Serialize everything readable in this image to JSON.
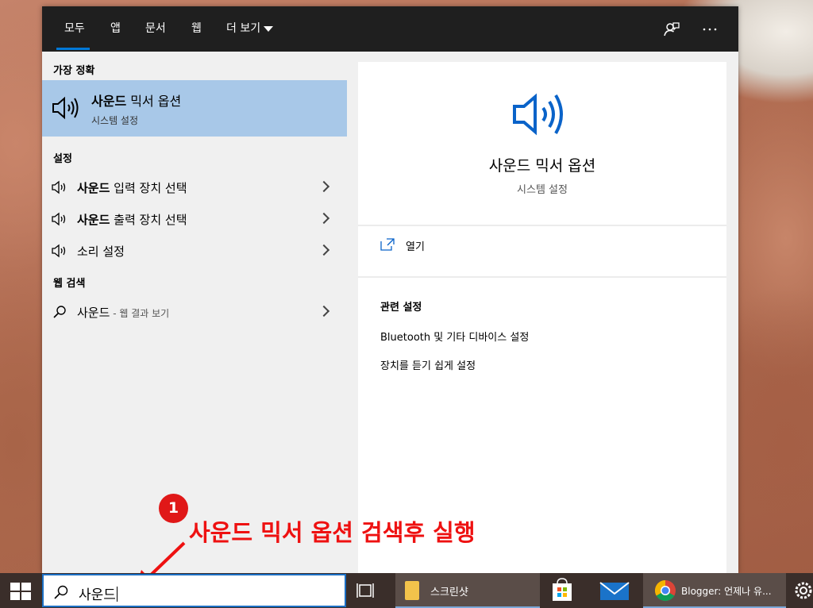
{
  "topnav": {
    "tabs": [
      "모두",
      "앱",
      "문서",
      "웹",
      "더 보기"
    ],
    "active_tab": "모두",
    "feedback_icon": "feedback-icon",
    "more_icon": "more-options-icon"
  },
  "left": {
    "best_match_heading": "가장 정확",
    "best_match": {
      "title_bold": "사운드",
      "title_rest": " 믹서 옵션",
      "subtitle": "시스템 설정",
      "icon": "speaker-icon"
    },
    "settings_heading": "설정",
    "settings_items": [
      {
        "bold": "사운드",
        "rest": " 입력 장치 선택"
      },
      {
        "bold": "사운드",
        "rest": " 출력 장치 선택"
      },
      {
        "bold": "",
        "rest": "소리 설정"
      }
    ],
    "web_heading": "웹 검색",
    "web_item": {
      "query": "사운드",
      "suffix": " - 웹 결과 보기"
    }
  },
  "right": {
    "title": "사운드 믹서 옵션",
    "subtitle": "시스템 설정",
    "open_label": "열기",
    "related_heading": "관련 설정",
    "related_links": [
      "Bluetooth 및 기타 디바이스 설정",
      "장치를 듣기 쉽게 설정"
    ]
  },
  "annotation": {
    "badge": "1",
    "text": "사운드 믹서 옵션 검색후 실행",
    "color": "#ee1111"
  },
  "taskbar": {
    "search_value": "사운드",
    "apps": [
      {
        "name": "folder",
        "label": "스크린샷"
      },
      {
        "name": "chrome",
        "label": "Blogger: 언제나 유..."
      }
    ]
  },
  "colors": {
    "accent": "#0078d7",
    "selection": "#a8c8e8",
    "nav_bg": "#1f1f1f",
    "taskbar_bg": "#3a2e2a"
  }
}
